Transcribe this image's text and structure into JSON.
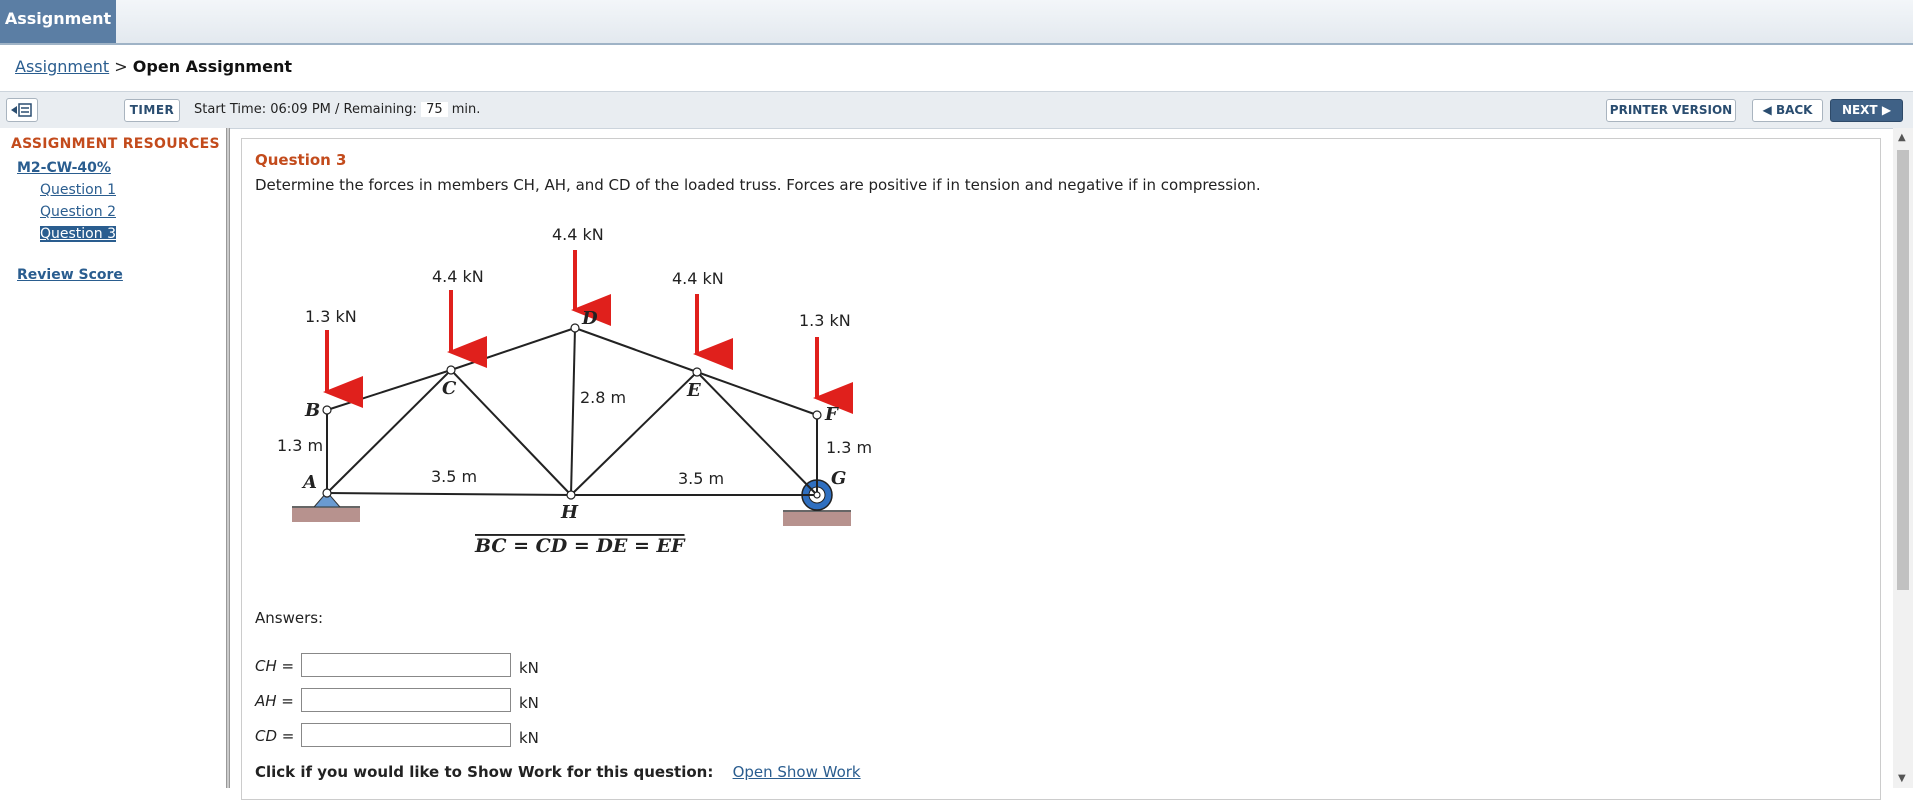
{
  "topbar": {
    "tab_label": "Assignment"
  },
  "breadcrumb": {
    "link": "Assignment",
    "sep": ">",
    "current": "Open Assignment"
  },
  "toolbar": {
    "timer_label": "TIMER",
    "start_text": "Start Time: 06:09 PM / Remaining:",
    "remaining": "75",
    "remaining_unit": "min.",
    "printer_label": "PRINTER VERSION",
    "back_label": "BACK",
    "next_label": "NEXT"
  },
  "sidebar": {
    "title": "ASSIGNMENT RESOURCES",
    "assignment": "M2-CW-40%",
    "questions": [
      "Question 1",
      "Question 2",
      "Question 3"
    ],
    "review": "Review Score"
  },
  "question": {
    "title": "Question 3",
    "text": "Determine the forces in members CH, AH, and CD of the loaded truss. Forces are positive if in tension and negative if in compression."
  },
  "figure": {
    "loads": [
      "1.3 kN",
      "4.4 kN",
      "4.4 kN",
      "4.4 kN",
      "1.3 kN"
    ],
    "nodes": [
      "A",
      "B",
      "C",
      "D",
      "E",
      "F",
      "G",
      "H"
    ],
    "dims": [
      "1.3 m",
      "2.8 m",
      "3.5 m",
      "3.5 m",
      "1.3 m"
    ],
    "equation": "BC = CD = DE = EF"
  },
  "answers": {
    "label": "Answers:",
    "rows": [
      {
        "name": "CH =",
        "unit": "kN",
        "value": ""
      },
      {
        "name": "AH =",
        "unit": "kN",
        "value": ""
      },
      {
        "name": "CD =",
        "unit": "kN",
        "value": ""
      }
    ]
  },
  "showwork": {
    "text": "Click if you would like to Show Work for this question:",
    "link": "Open Show Work"
  },
  "colors": {
    "accent": "#c34b1c",
    "link": "#2a5d8f",
    "load_arrow": "#e0201c",
    "tab": "#5b7ea4"
  }
}
